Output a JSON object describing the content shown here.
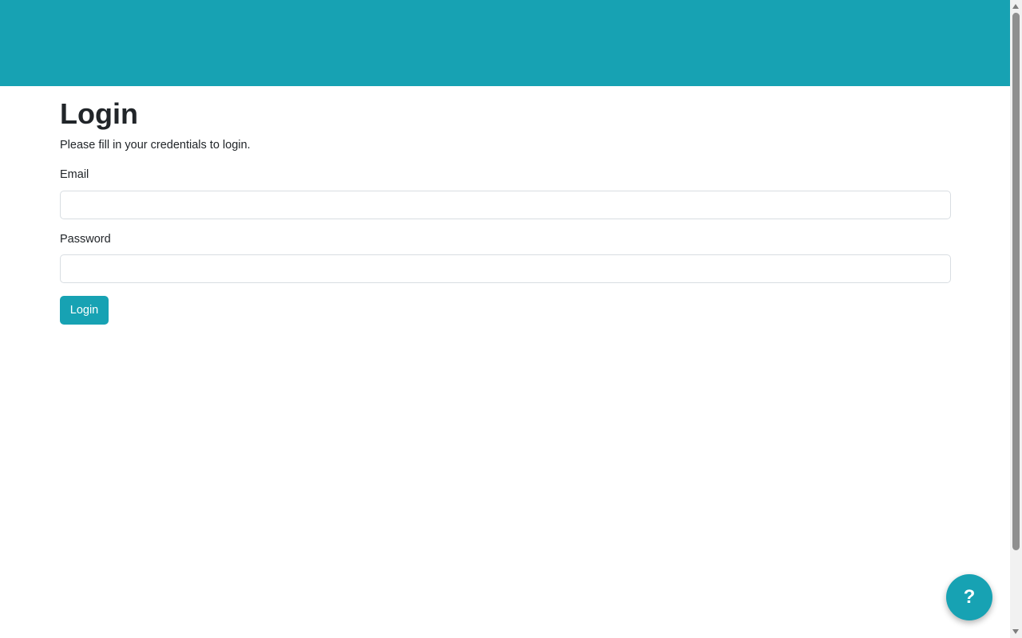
{
  "colors": {
    "accent": "#17a2b3",
    "text": "#212529",
    "input_border": "#d8dde2"
  },
  "page": {
    "title": "Login",
    "subtitle": "Please fill in your credentials to login."
  },
  "form": {
    "email": {
      "label": "Email",
      "value": "",
      "placeholder": ""
    },
    "password": {
      "label": "Password",
      "value": "",
      "placeholder": ""
    },
    "submit_label": "Login"
  },
  "help_button": {
    "label": "?",
    "icon": "question-mark-icon"
  }
}
